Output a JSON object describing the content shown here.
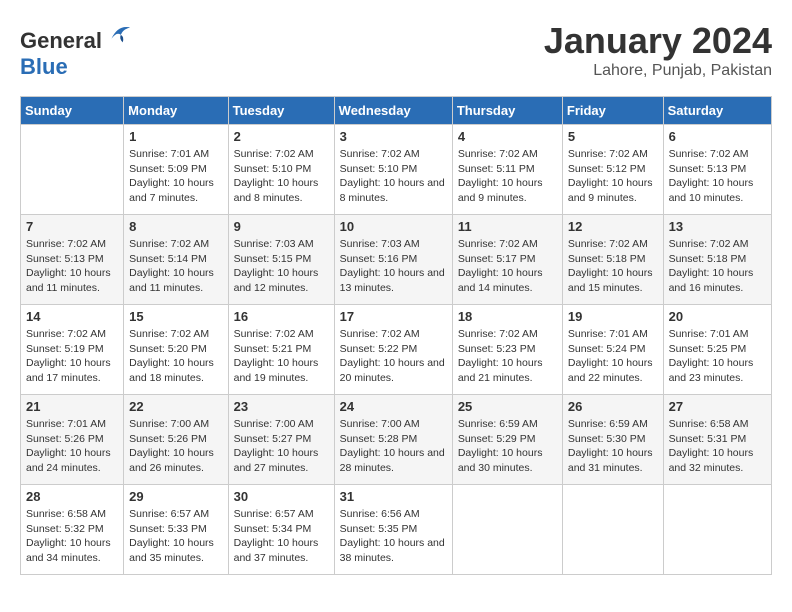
{
  "header": {
    "logo_general": "General",
    "logo_blue": "Blue",
    "month": "January 2024",
    "location": "Lahore, Punjab, Pakistan"
  },
  "weekdays": [
    "Sunday",
    "Monday",
    "Tuesday",
    "Wednesday",
    "Thursday",
    "Friday",
    "Saturday"
  ],
  "weeks": [
    [
      {
        "day": "",
        "sunrise": "",
        "sunset": "",
        "daylight": ""
      },
      {
        "day": "1",
        "sunrise": "Sunrise: 7:01 AM",
        "sunset": "Sunset: 5:09 PM",
        "daylight": "Daylight: 10 hours and 7 minutes."
      },
      {
        "day": "2",
        "sunrise": "Sunrise: 7:02 AM",
        "sunset": "Sunset: 5:10 PM",
        "daylight": "Daylight: 10 hours and 8 minutes."
      },
      {
        "day": "3",
        "sunrise": "Sunrise: 7:02 AM",
        "sunset": "Sunset: 5:10 PM",
        "daylight": "Daylight: 10 hours and 8 minutes."
      },
      {
        "day": "4",
        "sunrise": "Sunrise: 7:02 AM",
        "sunset": "Sunset: 5:11 PM",
        "daylight": "Daylight: 10 hours and 9 minutes."
      },
      {
        "day": "5",
        "sunrise": "Sunrise: 7:02 AM",
        "sunset": "Sunset: 5:12 PM",
        "daylight": "Daylight: 10 hours and 9 minutes."
      },
      {
        "day": "6",
        "sunrise": "Sunrise: 7:02 AM",
        "sunset": "Sunset: 5:13 PM",
        "daylight": "Daylight: 10 hours and 10 minutes."
      }
    ],
    [
      {
        "day": "7",
        "sunrise": "Sunrise: 7:02 AM",
        "sunset": "Sunset: 5:13 PM",
        "daylight": "Daylight: 10 hours and 11 minutes."
      },
      {
        "day": "8",
        "sunrise": "Sunrise: 7:02 AM",
        "sunset": "Sunset: 5:14 PM",
        "daylight": "Daylight: 10 hours and 11 minutes."
      },
      {
        "day": "9",
        "sunrise": "Sunrise: 7:03 AM",
        "sunset": "Sunset: 5:15 PM",
        "daylight": "Daylight: 10 hours and 12 minutes."
      },
      {
        "day": "10",
        "sunrise": "Sunrise: 7:03 AM",
        "sunset": "Sunset: 5:16 PM",
        "daylight": "Daylight: 10 hours and 13 minutes."
      },
      {
        "day": "11",
        "sunrise": "Sunrise: 7:02 AM",
        "sunset": "Sunset: 5:17 PM",
        "daylight": "Daylight: 10 hours and 14 minutes."
      },
      {
        "day": "12",
        "sunrise": "Sunrise: 7:02 AM",
        "sunset": "Sunset: 5:18 PM",
        "daylight": "Daylight: 10 hours and 15 minutes."
      },
      {
        "day": "13",
        "sunrise": "Sunrise: 7:02 AM",
        "sunset": "Sunset: 5:18 PM",
        "daylight": "Daylight: 10 hours and 16 minutes."
      }
    ],
    [
      {
        "day": "14",
        "sunrise": "Sunrise: 7:02 AM",
        "sunset": "Sunset: 5:19 PM",
        "daylight": "Daylight: 10 hours and 17 minutes."
      },
      {
        "day": "15",
        "sunrise": "Sunrise: 7:02 AM",
        "sunset": "Sunset: 5:20 PM",
        "daylight": "Daylight: 10 hours and 18 minutes."
      },
      {
        "day": "16",
        "sunrise": "Sunrise: 7:02 AM",
        "sunset": "Sunset: 5:21 PM",
        "daylight": "Daylight: 10 hours and 19 minutes."
      },
      {
        "day": "17",
        "sunrise": "Sunrise: 7:02 AM",
        "sunset": "Sunset: 5:22 PM",
        "daylight": "Daylight: 10 hours and 20 minutes."
      },
      {
        "day": "18",
        "sunrise": "Sunrise: 7:02 AM",
        "sunset": "Sunset: 5:23 PM",
        "daylight": "Daylight: 10 hours and 21 minutes."
      },
      {
        "day": "19",
        "sunrise": "Sunrise: 7:01 AM",
        "sunset": "Sunset: 5:24 PM",
        "daylight": "Daylight: 10 hours and 22 minutes."
      },
      {
        "day": "20",
        "sunrise": "Sunrise: 7:01 AM",
        "sunset": "Sunset: 5:25 PM",
        "daylight": "Daylight: 10 hours and 23 minutes."
      }
    ],
    [
      {
        "day": "21",
        "sunrise": "Sunrise: 7:01 AM",
        "sunset": "Sunset: 5:26 PM",
        "daylight": "Daylight: 10 hours and 24 minutes."
      },
      {
        "day": "22",
        "sunrise": "Sunrise: 7:00 AM",
        "sunset": "Sunset: 5:26 PM",
        "daylight": "Daylight: 10 hours and 26 minutes."
      },
      {
        "day": "23",
        "sunrise": "Sunrise: 7:00 AM",
        "sunset": "Sunset: 5:27 PM",
        "daylight": "Daylight: 10 hours and 27 minutes."
      },
      {
        "day": "24",
        "sunrise": "Sunrise: 7:00 AM",
        "sunset": "Sunset: 5:28 PM",
        "daylight": "Daylight: 10 hours and 28 minutes."
      },
      {
        "day": "25",
        "sunrise": "Sunrise: 6:59 AM",
        "sunset": "Sunset: 5:29 PM",
        "daylight": "Daylight: 10 hours and 30 minutes."
      },
      {
        "day": "26",
        "sunrise": "Sunrise: 6:59 AM",
        "sunset": "Sunset: 5:30 PM",
        "daylight": "Daylight: 10 hours and 31 minutes."
      },
      {
        "day": "27",
        "sunrise": "Sunrise: 6:58 AM",
        "sunset": "Sunset: 5:31 PM",
        "daylight": "Daylight: 10 hours and 32 minutes."
      }
    ],
    [
      {
        "day": "28",
        "sunrise": "Sunrise: 6:58 AM",
        "sunset": "Sunset: 5:32 PM",
        "daylight": "Daylight: 10 hours and 34 minutes."
      },
      {
        "day": "29",
        "sunrise": "Sunrise: 6:57 AM",
        "sunset": "Sunset: 5:33 PM",
        "daylight": "Daylight: 10 hours and 35 minutes."
      },
      {
        "day": "30",
        "sunrise": "Sunrise: 6:57 AM",
        "sunset": "Sunset: 5:34 PM",
        "daylight": "Daylight: 10 hours and 37 minutes."
      },
      {
        "day": "31",
        "sunrise": "Sunrise: 6:56 AM",
        "sunset": "Sunset: 5:35 PM",
        "daylight": "Daylight: 10 hours and 38 minutes."
      },
      {
        "day": "",
        "sunrise": "",
        "sunset": "",
        "daylight": ""
      },
      {
        "day": "",
        "sunrise": "",
        "sunset": "",
        "daylight": ""
      },
      {
        "day": "",
        "sunrise": "",
        "sunset": "",
        "daylight": ""
      }
    ]
  ]
}
